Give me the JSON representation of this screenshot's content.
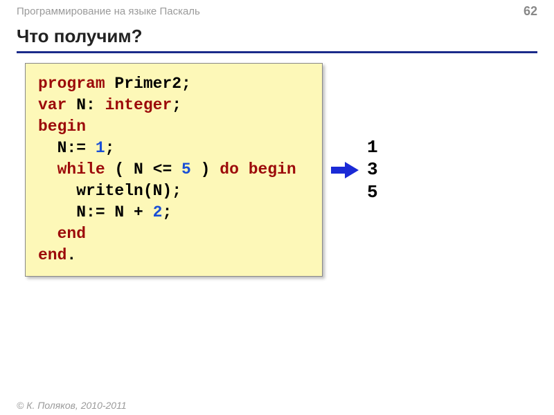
{
  "header": {
    "breadcrumb": "Программирование на языке Паскаль",
    "page_number": "62"
  },
  "title": "Что получим?",
  "code": {
    "line1_kw1": "program",
    "line1_rest": " Primer2;",
    "line2_kw1": "var",
    "line2_mid": " N: ",
    "line2_kw2": "integer",
    "line2_end": ";",
    "line3_kw": "begin",
    "line4_pre": "  N:= ",
    "line4_num": "1",
    "line4_end": ";",
    "line5_pre": "  ",
    "line5_kw1": "while",
    "line5_mid1": " ( N <= ",
    "line5_num": "5",
    "line5_mid2": " ) ",
    "line5_kw2": "do begin",
    "line6": "    writeln(N);",
    "line7_pre": "    N:= N + ",
    "line7_num": "2",
    "line7_end": ";",
    "line8_pre": "  ",
    "line8_kw": "end",
    "line9_kw": "end",
    "line9_end": "."
  },
  "output": {
    "line1": "1",
    "line2": "3",
    "line3": "5"
  },
  "footer": "© К. Поляков, 2010-2011"
}
